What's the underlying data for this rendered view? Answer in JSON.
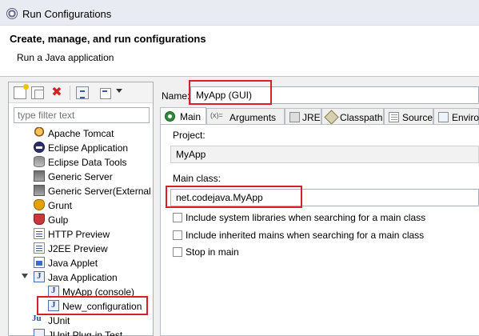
{
  "window": {
    "title": "Run Configurations"
  },
  "header": {
    "title": "Create, manage, and run configurations",
    "subtitle": "Run a Java application"
  },
  "sidebar": {
    "filter_placeholder": "type filter text",
    "items": [
      {
        "label": "Apache Tomcat",
        "icon": "tomcat-icon"
      },
      {
        "label": "Eclipse Application",
        "icon": "eclipse-icon"
      },
      {
        "label": "Eclipse Data Tools",
        "icon": "database-icon"
      },
      {
        "label": "Generic Server",
        "icon": "server-icon"
      },
      {
        "label": "Generic Server(External l",
        "icon": "server-icon"
      },
      {
        "label": "Grunt",
        "icon": "grunt-icon"
      },
      {
        "label": "Gulp",
        "icon": "gulp-icon"
      },
      {
        "label": "HTTP Preview",
        "icon": "http-preview-icon"
      },
      {
        "label": "J2EE Preview",
        "icon": "j2ee-preview-icon"
      },
      {
        "label": "Java Applet",
        "icon": "applet-icon"
      },
      {
        "label": "Java Application",
        "icon": "java-app-icon",
        "expanded": true
      },
      {
        "label": "MyApp (console)",
        "icon": "java-app-icon",
        "child": true
      },
      {
        "label": "New_configuration",
        "icon": "java-app-icon",
        "child": true,
        "selected": true
      },
      {
        "label": "JUnit",
        "icon": "junit-icon"
      },
      {
        "label": "JUnit Plug-in Test",
        "icon": "junit-icon"
      }
    ]
  },
  "config": {
    "name_label": "Name:",
    "name_value": "MyApp (GUI)",
    "tabs": [
      {
        "label": "Main",
        "active": true
      },
      {
        "label": "Arguments"
      },
      {
        "label": "JRE"
      },
      {
        "label": "Classpath"
      },
      {
        "label": "Source"
      },
      {
        "label": "Enviro"
      }
    ],
    "project_label": "Project:",
    "project_value": "MyApp",
    "main_class_label": "Main class:",
    "main_class_value": "net.codejava.MyApp",
    "options": [
      {
        "label": "Include system libraries when searching for a main class",
        "checked": false
      },
      {
        "label": "Include inherited mains when searching for a main class",
        "checked": false
      },
      {
        "label": "Stop in main",
        "checked": false
      }
    ]
  },
  "colors": {
    "highlight_red": "#d8202a"
  }
}
